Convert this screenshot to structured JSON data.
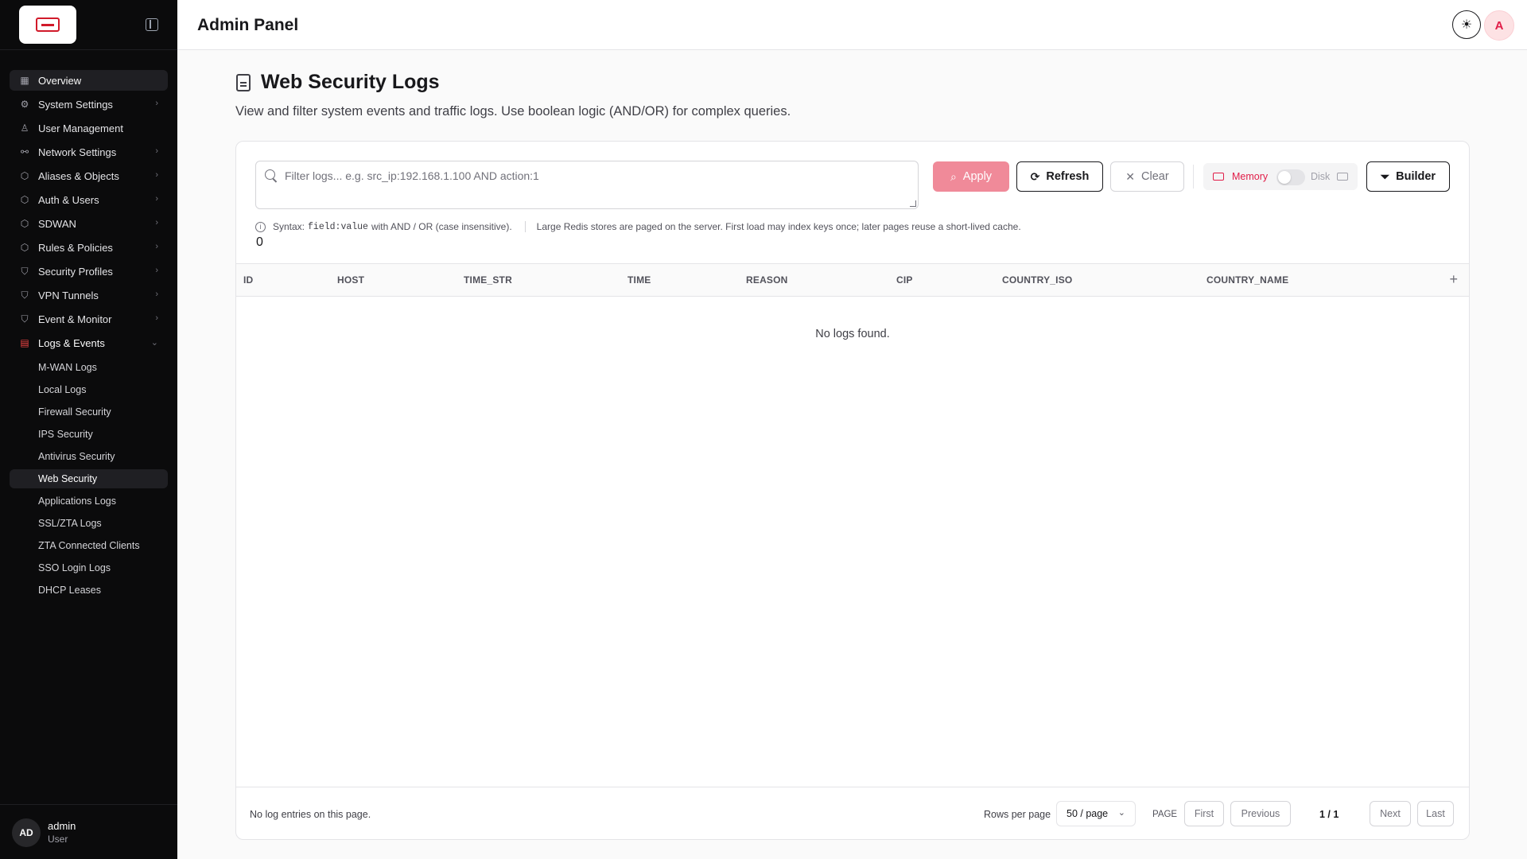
{
  "sidebar": {
    "items": [
      {
        "label": "Overview",
        "icon": "grid-icon",
        "active": true
      },
      {
        "label": "System Settings",
        "icon": "gear-icon"
      },
      {
        "label": "User Management",
        "icon": "user-icon"
      },
      {
        "label": "Network Settings",
        "icon": "network-icon"
      },
      {
        "label": "Aliases & Objects",
        "icon": "box-icon"
      },
      {
        "label": "Auth & Users",
        "icon": "box-icon"
      },
      {
        "label": "SDWAN",
        "icon": "box-icon"
      },
      {
        "label": "Rules & Policies",
        "icon": "box-icon"
      },
      {
        "label": "Security Profiles",
        "icon": "shield-icon"
      },
      {
        "label": "VPN Tunnels",
        "icon": "shield-icon"
      },
      {
        "label": "Event & Monitor",
        "icon": "shield-icon"
      },
      {
        "label": "Logs & Events",
        "icon": "document-icon"
      }
    ],
    "sub_items": [
      "M-WAN Logs",
      "Local Logs",
      "Firewall Security",
      "IPS Security",
      "Antivirus Security",
      "Web Security",
      "Applications Logs",
      "SSL/ZTA Logs",
      "ZTA Connected Clients",
      "SSO Login Logs",
      "DHCP Leases"
    ],
    "user": {
      "initials": "AD",
      "name": "admin",
      "role": "User"
    }
  },
  "header": {
    "title": "Admin Panel",
    "avatar": "A"
  },
  "main": {
    "title": "Web Security Logs",
    "description": "View and filter system events and traffic logs. Use boolean logic (AND/OR) for complex queries.",
    "filter_placeholder": "Filter logs... e.g. src_ip:192.168.1.100 AND action:1",
    "buttons": {
      "apply": "Apply",
      "refresh": "Refresh",
      "clear": "Clear",
      "builder": "Builder"
    },
    "storage": {
      "memory": "Memory",
      "disk": "Disk"
    },
    "syntax": {
      "prefix": "Syntax:",
      "code": "field:value",
      "with": "with AND / OR (case insensitive).",
      "note": "Large Redis stores are paged on the server. First load may index keys once; later pages reuse a short-lived cache."
    },
    "count": "0",
    "columns": [
      "ID",
      "HOST",
      "TIME_STR",
      "TIME",
      "REASON",
      "CIP",
      "COUNTRY_ISO",
      "COUNTRY_NAME"
    ],
    "empty": "No logs found.",
    "footer": {
      "note": "No log entries on this page.",
      "rows_label": "Rows per page",
      "rows_value": "50 / page",
      "page_label": "PAGE",
      "first": "First",
      "previous": "Previous",
      "page_info": "1 / 1",
      "next": "Next",
      "last": "Last"
    }
  },
  "colors": {
    "accent": "#e11d48",
    "apply_bg": "#f08a99",
    "sidebar_bg": "#0b0b0c"
  }
}
